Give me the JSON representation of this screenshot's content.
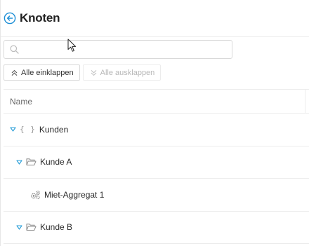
{
  "header": {
    "title": "Knoten",
    "back_icon": "arrow-left-circle-icon"
  },
  "search": {
    "placeholder": "",
    "value": ""
  },
  "toolbar": {
    "collapse_all_label": "Alle einklappen",
    "expand_all_label": "Alle ausklappen",
    "expand_all_disabled": true
  },
  "table": {
    "columns": [
      "Name"
    ],
    "rows": [
      {
        "label": "Kunden",
        "icon": "braces-icon",
        "level": 0,
        "expanded": true
      },
      {
        "label": "Kunde A",
        "icon": "folder-open-icon",
        "level": 1,
        "expanded": true
      },
      {
        "label": "Miet-Aggregat 1",
        "icon": "gears-icon",
        "level": 2,
        "expanded": false
      },
      {
        "label": "Kunde B",
        "icon": "folder-open-icon",
        "level": 1,
        "expanded": true
      }
    ]
  },
  "colors": {
    "accent": "#1e8fd6",
    "caret": "#2a9fd8",
    "border": "#e6e6e6"
  }
}
